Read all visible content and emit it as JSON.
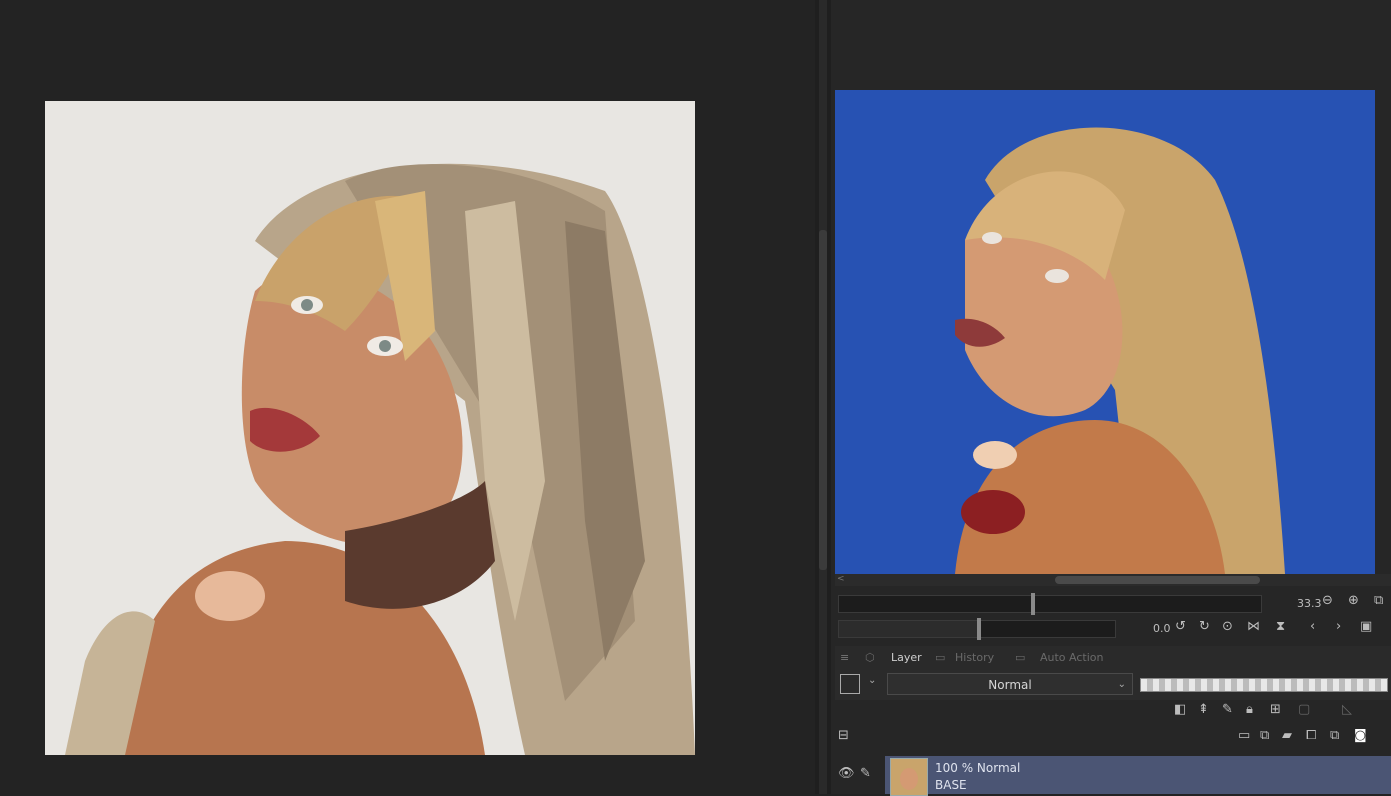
{
  "nav_panel": {
    "zoom_value": "33.3",
    "rotate_value": "0.0"
  },
  "layer_panel": {
    "tabs": [
      {
        "label": "Layer",
        "active": true
      },
      {
        "label": "History",
        "active": false
      },
      {
        "label": "Auto Action",
        "active": false
      }
    ],
    "blend_mode": "Normal",
    "layer": {
      "opacity_mode": "100 % Normal",
      "name": "BASE"
    }
  },
  "colors": {
    "canvas_paper": "#e8e6e2",
    "reference_bg": "#2752b3",
    "selected_layer": "#4b5574",
    "ui_dark": "#232323"
  }
}
